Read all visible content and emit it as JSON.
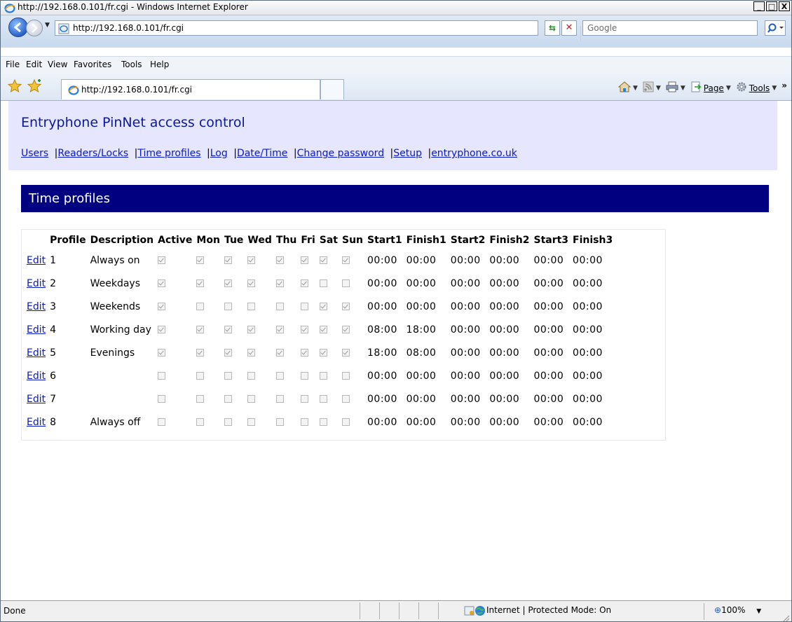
{
  "window": {
    "title": "http://192.168.0.101/fr.cgi - Windows Internet Explorer",
    "controls": [
      "_",
      "□",
      "X"
    ]
  },
  "address_bar": {
    "url": "http://192.168.0.101/fr.cgi",
    "search_placeholder": "Google"
  },
  "menu": [
    "File",
    "Edit",
    "View",
    "Favorites",
    "Tools",
    "Help"
  ],
  "tab": {
    "title": "http://192.168.0.101/fr.cgi"
  },
  "command_bar": {
    "page_label": "Page",
    "tools_label": "Tools"
  },
  "page": {
    "heading": "Entryphone PinNet access control",
    "nav_links": [
      "Users",
      "Readers/Locks",
      "Time profiles",
      "Log",
      "Date/Time",
      "Change password",
      "Setup",
      "entryphone.co.uk"
    ],
    "section_title": "Time profiles",
    "table": {
      "columns": [
        "",
        "Profile",
        "Description",
        "Active",
        "Mon",
        "Tue",
        "Wed",
        "Thu",
        "Fri",
        "Sat",
        "Sun",
        "Start1",
        "Finish1",
        "Start2",
        "Finish2",
        "Start3",
        "Finish3"
      ],
      "edit_label": "Edit",
      "rows": [
        {
          "profile": "1",
          "description": "Always on",
          "active": true,
          "days": [
            true,
            true,
            true,
            true,
            true,
            true,
            true
          ],
          "times": [
            "00:00",
            "00:00",
            "00:00",
            "00:00",
            "00:00",
            "00:00"
          ]
        },
        {
          "profile": "2",
          "description": "Weekdays",
          "active": true,
          "days": [
            true,
            true,
            true,
            true,
            true,
            false,
            false
          ],
          "times": [
            "00:00",
            "00:00",
            "00:00",
            "00:00",
            "00:00",
            "00:00"
          ]
        },
        {
          "profile": "3",
          "description": "Weekends",
          "active": true,
          "days": [
            false,
            false,
            false,
            false,
            false,
            true,
            true
          ],
          "times": [
            "00:00",
            "00:00",
            "00:00",
            "00:00",
            "00:00",
            "00:00"
          ]
        },
        {
          "profile": "4",
          "description": "Working day",
          "active": true,
          "days": [
            true,
            true,
            true,
            true,
            true,
            true,
            true
          ],
          "times": [
            "08:00",
            "18:00",
            "00:00",
            "00:00",
            "00:00",
            "00:00"
          ]
        },
        {
          "profile": "5",
          "description": "Evenings",
          "active": true,
          "days": [
            true,
            true,
            true,
            true,
            true,
            true,
            true
          ],
          "times": [
            "18:00",
            "08:00",
            "00:00",
            "00:00",
            "00:00",
            "00:00"
          ]
        },
        {
          "profile": "6",
          "description": "",
          "active": false,
          "days": [
            false,
            false,
            false,
            false,
            false,
            false,
            false
          ],
          "times": [
            "00:00",
            "00:00",
            "00:00",
            "00:00",
            "00:00",
            "00:00"
          ]
        },
        {
          "profile": "7",
          "description": "",
          "active": false,
          "days": [
            false,
            false,
            false,
            false,
            false,
            false,
            false
          ],
          "times": [
            "00:00",
            "00:00",
            "00:00",
            "00:00",
            "00:00",
            "00:00"
          ]
        },
        {
          "profile": "8",
          "description": "Always off",
          "active": false,
          "days": [
            false,
            false,
            false,
            false,
            false,
            false,
            false
          ],
          "times": [
            "00:00",
            "00:00",
            "00:00",
            "00:00",
            "00:00",
            "00:00"
          ]
        }
      ]
    }
  },
  "status_bar": {
    "text": "Done",
    "zone": "Internet | Protected Mode: On",
    "zoom": "100%"
  }
}
